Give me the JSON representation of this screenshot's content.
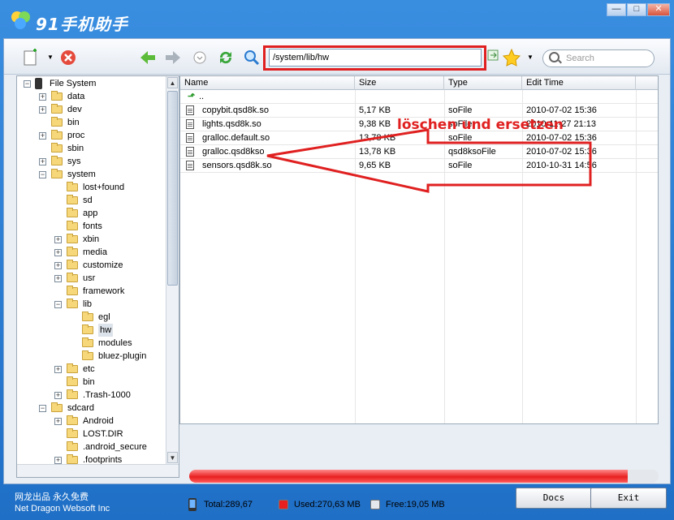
{
  "app": {
    "title": "91手机助手"
  },
  "window_buttons": {
    "minimize": "—",
    "close": "✕"
  },
  "toolbar": {
    "address": "/system/lib/hw",
    "search_placeholder": "Search"
  },
  "tree": {
    "nodes": [
      {
        "label": "File System",
        "expander": "−"
      },
      {
        "label": "data",
        "expander": "+"
      },
      {
        "label": "dev",
        "expander": "+"
      },
      {
        "label": "bin",
        "expander": ""
      },
      {
        "label": "proc",
        "expander": "+"
      },
      {
        "label": "sbin",
        "expander": ""
      },
      {
        "label": "sys",
        "expander": "+"
      },
      {
        "label": "system",
        "expander": "−"
      },
      {
        "label": "lost+found",
        "expander": ""
      },
      {
        "label": "sd",
        "expander": ""
      },
      {
        "label": "app",
        "expander": ""
      },
      {
        "label": "fonts",
        "expander": ""
      },
      {
        "label": "xbin",
        "expander": "+"
      },
      {
        "label": "media",
        "expander": "+"
      },
      {
        "label": "customize",
        "expander": "+"
      },
      {
        "label": "usr",
        "expander": "+"
      },
      {
        "label": "framework",
        "expander": ""
      },
      {
        "label": "lib",
        "expander": "−"
      },
      {
        "label": "egl",
        "expander": ""
      },
      {
        "label": "hw",
        "expander": ""
      },
      {
        "label": "modules",
        "expander": ""
      },
      {
        "label": "bluez-plugin",
        "expander": ""
      },
      {
        "label": "etc",
        "expander": "+"
      },
      {
        "label": "bin",
        "expander": ""
      },
      {
        "label": ".Trash-1000",
        "expander": "+"
      },
      {
        "label": "sdcard",
        "expander": "−"
      },
      {
        "label": "Android",
        "expander": "+"
      },
      {
        "label": "LOST.DIR",
        "expander": ""
      },
      {
        "label": ".android_secure",
        "expander": ""
      },
      {
        "label": ".footprints",
        "expander": "+"
      }
    ]
  },
  "list": {
    "columns": [
      "Name",
      "Size",
      "Type",
      "Edit Time"
    ],
    "parent_label": "..",
    "rows": [
      {
        "name": "copybit.qsd8k.so",
        "size": "5,17 KB",
        "type": "soFile",
        "time": "2010-07-02 15:36"
      },
      {
        "name": "lights.qsd8k.so",
        "size": "9,38 KB",
        "type": "soFile",
        "time": "2010-11-27 21:13"
      },
      {
        "name": "gralloc.default.so",
        "size": "13,78 KB",
        "type": "soFile",
        "time": "2010-07-02 15:36"
      },
      {
        "name": "gralloc.qsd8kso",
        "size": "13,78 KB",
        "type": "qsd8ksoFile",
        "time": "2010-07-02 15:36"
      },
      {
        "name": "sensors.qsd8k.so",
        "size": "9,65 KB",
        "type": "soFile",
        "time": "2010-10-31 14:56"
      }
    ]
  },
  "annotation": {
    "text": "löschen und ersetzen",
    "color": "#e02020"
  },
  "storage": {
    "used_fraction": 0.934,
    "total": "Total:289,67 MB",
    "used": "Used:270,63 MB",
    "free": "Free:19,05 MB",
    "used_color": "#e82020",
    "free_color": "#e4e7eb"
  },
  "footer": {
    "line1": "网龙出品 永久免费",
    "line2": "Net Dragon Websoft Inc",
    "docs": "Docs",
    "exit": "Exit"
  }
}
